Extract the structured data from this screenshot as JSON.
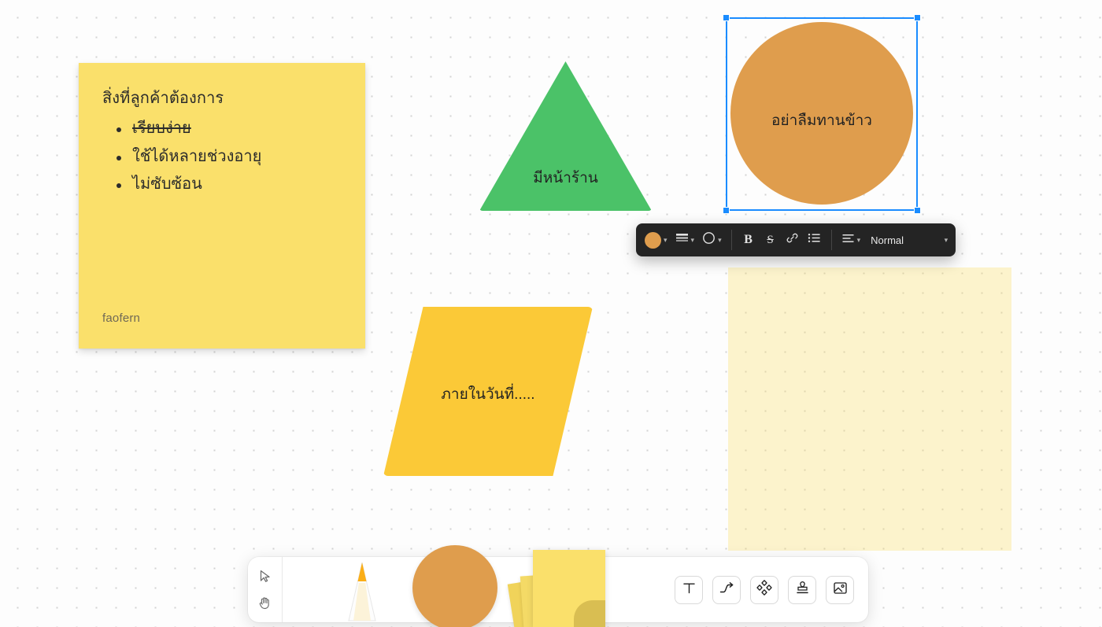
{
  "app": {
    "name": "whiteboard-canvas"
  },
  "canvas": {
    "sticky_note": {
      "title": "สิ่งที่ลูกค้าต้องการ",
      "author": "faofern",
      "color": "#FAE06B",
      "items": [
        {
          "text": "เรียบง่าย",
          "struck": true
        },
        {
          "text": "ใช้ได้หลายช่วงอายุ",
          "struck": false
        },
        {
          "text": "ไม่ซับซ้อน",
          "struck": false
        }
      ]
    },
    "shapes": [
      {
        "kind": "triangle",
        "label": "มีหน้าร้าน",
        "color": "#4BC268",
        "selected": false
      },
      {
        "kind": "circle",
        "label": "อย่าลืมทานข้าว",
        "color": "#DF9D4D",
        "selected": true
      },
      {
        "kind": "parallelogram",
        "label": "ภายในวันที่.....",
        "color": "#FBC937",
        "selected": false
      },
      {
        "kind": "rectangle",
        "label": "",
        "color": "#FAE06B",
        "selected": false
      }
    ]
  },
  "format_toolbar": {
    "color_swatch": "#DF9D4D",
    "color_icon": "color-circle",
    "stroke_icon": "stroke-weight",
    "shape_icon": "shape-outline",
    "bold_label": "B",
    "strike_label": "S",
    "link_icon": "link",
    "list_icon": "bullet-list",
    "align_icon": "text-align",
    "size_label": "Normal"
  },
  "tool_dock": {
    "select_icon": "cursor-arrow",
    "pan_icon": "hand",
    "pen_icon": "pen",
    "shape_icon": "circle-shape",
    "note_icon": "sticky-note-stack",
    "text_icon": "text-tool",
    "connector_icon": "connector-arrow",
    "shapes_icon": "shapes-diamond",
    "stamp_icon": "stamp",
    "image_icon": "image"
  }
}
